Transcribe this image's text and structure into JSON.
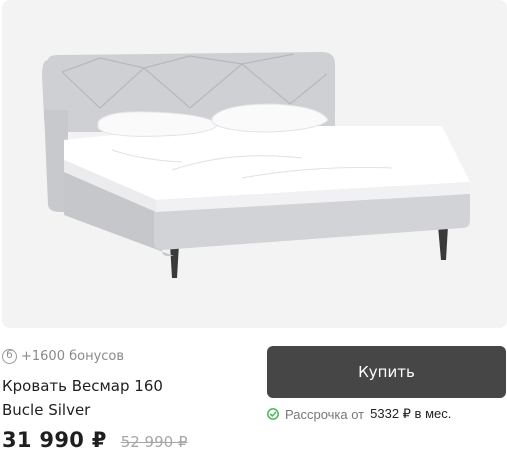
{
  "product": {
    "image_icon": "bed-image",
    "bonus": {
      "icon": "bonus-coin-icon",
      "icon_glyph": "б",
      "text": "+1600 бонусов"
    },
    "title_line1": "Кровать Весмар 160",
    "title_line2": "Bucle Silver",
    "price": "31 990 ₽",
    "old_price": "52 990 ₽",
    "buy_label": "Купить",
    "installment": {
      "icon": "check-circle-icon",
      "prefix": "Рассрочка от",
      "amount": "5332 ₽ в мес."
    }
  },
  "colors": {
    "background": "#ffffff",
    "image_background": "#f3f3f3",
    "button": "#464646",
    "button_text": "#ffffff",
    "muted_text": "#8a8a8a",
    "check_green": "#3fb34f"
  }
}
